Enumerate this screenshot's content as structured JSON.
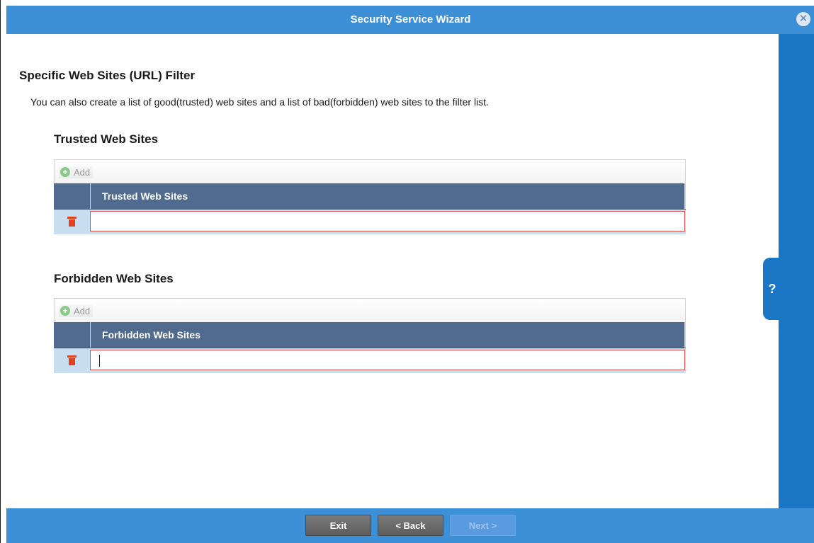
{
  "window": {
    "title": "Security Service Wizard",
    "close_icon": "close-icon"
  },
  "page": {
    "section_title": "Specific Web Sites (URL) Filter",
    "description": "You can also create a list of good(trusted) web sites and a list of bad(forbidden) web sites to the filter list."
  },
  "trusted": {
    "group_title": "Trusted Web Sites",
    "add_label": "Add",
    "column_header": "Trusted Web Sites",
    "rows": [
      {
        "value": ""
      }
    ]
  },
  "forbidden": {
    "group_title": "Forbidden Web Sites",
    "add_label": "Add",
    "column_header": "Forbidden Web Sites",
    "rows": [
      {
        "value": ""
      }
    ]
  },
  "help": {
    "label": "?"
  },
  "footer": {
    "exit_label": "Exit",
    "back_label": "< Back",
    "next_label": "Next >"
  },
  "colors": {
    "title_bar": "#3d8fd6",
    "help_strip": "#1b77c6",
    "table_header": "#516b8f",
    "row_bg": "#c9def1",
    "trash": "#e2421d"
  }
}
